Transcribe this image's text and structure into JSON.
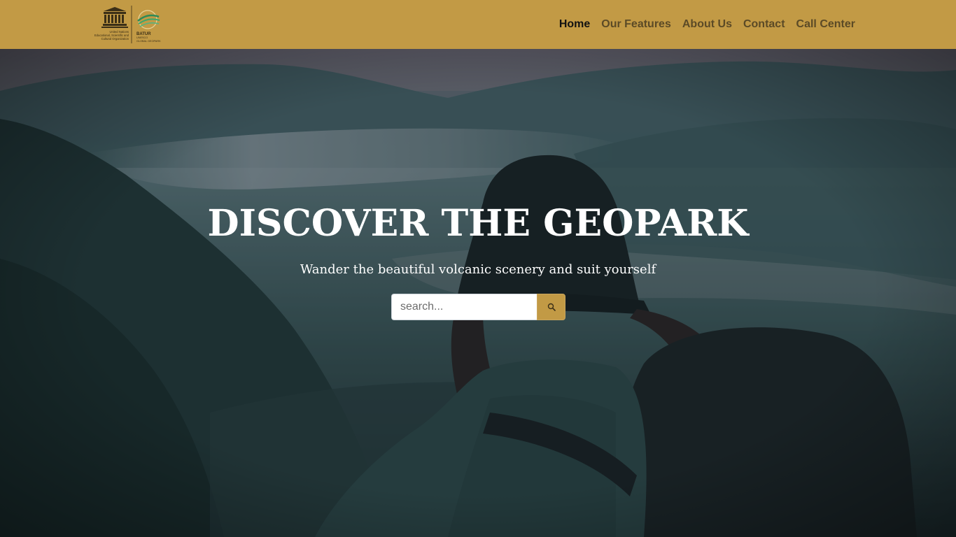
{
  "header": {
    "logo": {
      "unesco_text": "UNESCO",
      "org_line1": "United Nations",
      "org_line2": "Educational, Scientific and",
      "org_line3": "Cultural Organization",
      "geopark_line1": "BATUR",
      "geopark_line2": "UNESCO",
      "geopark_line3": "GLOBAL GEOPARK"
    },
    "nav": [
      {
        "label": "Home",
        "active": true
      },
      {
        "label": "Our Features",
        "active": false
      },
      {
        "label": "About Us",
        "active": false
      },
      {
        "label": "Contact",
        "active": false
      },
      {
        "label": "Call Center",
        "active": false
      }
    ]
  },
  "hero": {
    "title": "DISCOVER THE GEOPARK",
    "subtitle": "Wander the beautiful volcanic scenery and suit yourself",
    "search": {
      "placeholder": "search...",
      "value": "",
      "button_icon": "search-icon"
    }
  },
  "colors": {
    "navbar": "#c29a45",
    "nav_text": "#5b4a26",
    "nav_active": "#111111",
    "search_button": "#c29a45"
  }
}
